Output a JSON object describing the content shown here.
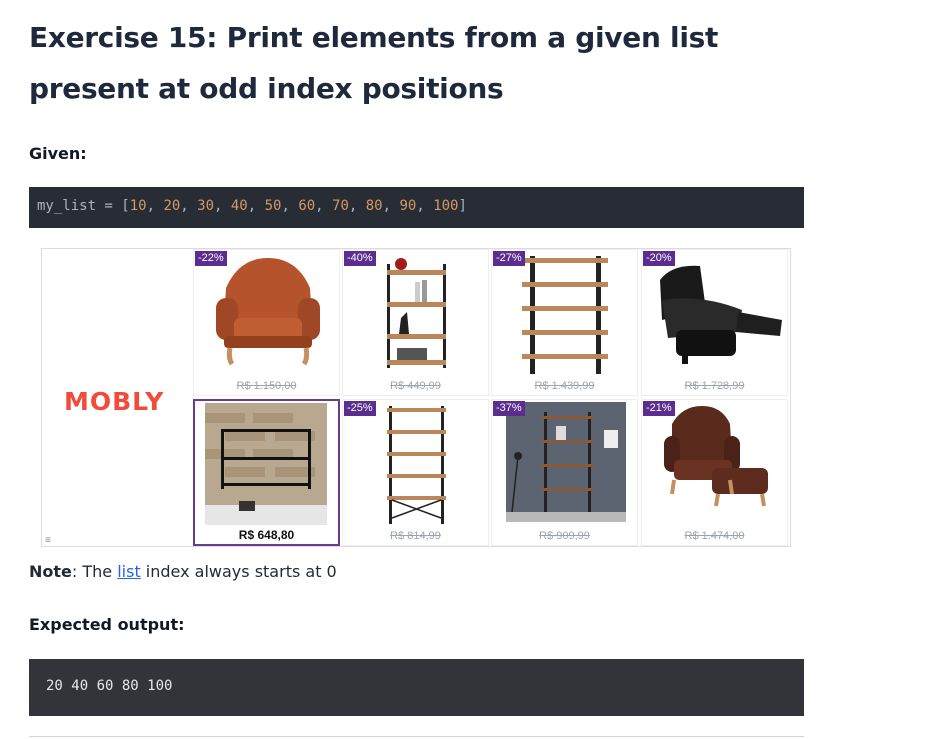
{
  "exercise": {
    "title": "Exercise 15: Print elements from a given list present at odd index positions",
    "given_label": "Given:",
    "given_code": {
      "prefix": "my_list = [",
      "numbers": [
        "10",
        "20",
        "30",
        "40",
        "50",
        "60",
        "70",
        "80",
        "90",
        "100"
      ],
      "suffix": "]"
    },
    "note": {
      "bold": "Note",
      "before_link": ": The ",
      "link": "list",
      "after_link": " index always starts at 0"
    },
    "expected_label": "Expected output:",
    "expected_output": "20 40 60 80 100"
  },
  "ad": {
    "brand": "MOBLY",
    "info_icon": "≡",
    "products": [
      {
        "badge": "-22%",
        "price": "R$ 1.150,00",
        "icon": "armchair-icon",
        "strike": true
      },
      {
        "badge": "-40%",
        "price": "R$ 449,99",
        "icon": "bookshelf-icon",
        "strike": true
      },
      {
        "badge": "-27%",
        "price": "R$ 1.439,99",
        "icon": "shelf-icon",
        "strike": true
      },
      {
        "badge": "-20%",
        "price": "R$ 1.728,99",
        "icon": "recliner-icon",
        "strike": true
      },
      {
        "badge": "",
        "price": "R$ 648,80",
        "icon": "wall-shelf-icon",
        "strike": false
      },
      {
        "badge": "-25%",
        "price": "R$ 814,99",
        "icon": "tall-shelf-icon",
        "strike": true
      },
      {
        "badge": "-37%",
        "price": "R$ 909,99",
        "icon": "room-shelf-icon",
        "strike": true
      },
      {
        "badge": "-21%",
        "price": "R$ 1.474,00",
        "icon": "armchair-ottoman-icon",
        "strike": true
      }
    ],
    "colors": {
      "badge": "#5b2d8e",
      "brand": "#ef4c3b",
      "selected_border": "#6b3a8c"
    }
  }
}
